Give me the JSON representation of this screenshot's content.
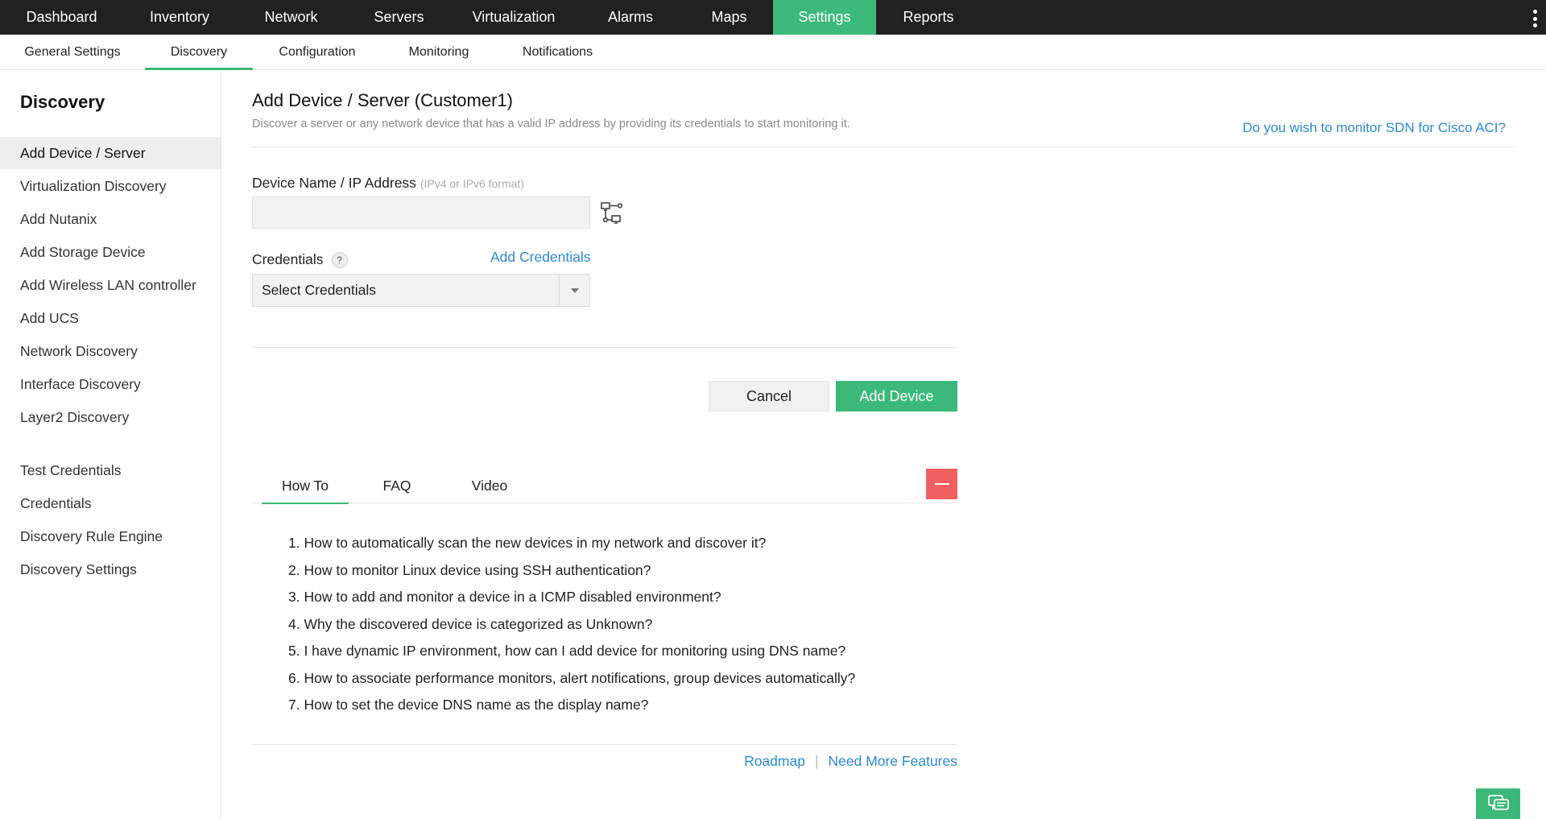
{
  "topnav": {
    "items": [
      {
        "label": "Dashboard",
        "active": false
      },
      {
        "label": "Inventory",
        "active": false
      },
      {
        "label": "Network",
        "active": false
      },
      {
        "label": "Servers",
        "active": false
      },
      {
        "label": "Virtualization",
        "active": false
      },
      {
        "label": "Alarms",
        "active": false
      },
      {
        "label": "Maps",
        "active": false
      },
      {
        "label": "Settings",
        "active": true
      },
      {
        "label": "Reports",
        "active": false
      }
    ],
    "active_color": "#3cb97a",
    "background": "#212121"
  },
  "subnav": {
    "tabs": [
      {
        "label": "General Settings",
        "active": false
      },
      {
        "label": "Discovery",
        "active": true
      },
      {
        "label": "Configuration",
        "active": false
      },
      {
        "label": "Monitoring",
        "active": false
      },
      {
        "label": "Notifications",
        "active": false
      }
    ]
  },
  "sidebar": {
    "title": "Discovery",
    "items": [
      {
        "label": "Add Device / Server",
        "active": true
      },
      {
        "label": "Virtualization Discovery",
        "active": false
      },
      {
        "label": "Add Nutanix",
        "active": false
      },
      {
        "label": "Add Storage Device",
        "active": false
      },
      {
        "label": "Add Wireless LAN controller",
        "active": false
      },
      {
        "label": "Add UCS",
        "active": false
      },
      {
        "label": "Network Discovery",
        "active": false
      },
      {
        "label": "Interface Discovery",
        "active": false
      },
      {
        "label": "Layer2 Discovery",
        "active": false
      },
      {
        "label": "Test Credentials",
        "active": false
      },
      {
        "label": "Credentials",
        "active": false
      },
      {
        "label": "Discovery Rule Engine",
        "active": false
      },
      {
        "label": "Discovery Settings",
        "active": false
      }
    ]
  },
  "main": {
    "title": "Add Device / Server (Customer1)",
    "description": "Discover a server or any network device that has a valid IP address by providing its credentials to start monitoring it.",
    "sdn_link": "Do you wish to monitor SDN for Cisco ACI?",
    "device_field": {
      "label": "Device Name / IP Address",
      "hint": "(IPv4 or IPv6 format)",
      "value": "",
      "icon": "network-topology-icon"
    },
    "credentials": {
      "label": "Credentials",
      "help_icon_text": "?",
      "add_link": "Add Credentials",
      "selected": "Select Credentials"
    },
    "buttons": {
      "cancel": "Cancel",
      "add": "Add Device"
    }
  },
  "help": {
    "tabs": [
      {
        "label": "How To",
        "active": true
      },
      {
        "label": "FAQ",
        "active": false
      },
      {
        "label": "Video",
        "active": false
      }
    ],
    "items": [
      "1. How to automatically scan the new devices in my network and discover it?",
      "2. How to monitor Linux device using SSH authentication?",
      "3. How to add and monitor a device in a ICMP disabled environment?",
      "4. Why the discovered device is categorized as Unknown?",
      "5. I have dynamic IP environment, how can I add device for monitoring using DNS name?",
      "6. How to associate performance monitors, alert notifications, group devices automatically?",
      "7. How to set the device DNS name as the display name?"
    ],
    "collapse_color": "#f06060"
  },
  "footer": {
    "roadmap": "Roadmap",
    "separator": "|",
    "more_features": "Need More Features",
    "chat_icon": "chat-icon"
  }
}
